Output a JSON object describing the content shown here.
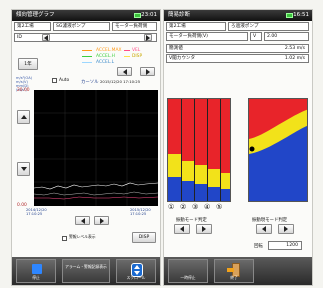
{
  "left": {
    "title": "傾向管理グラフ",
    "time": "23:01",
    "battery_color": "#3cc23c",
    "field1": "第2工場",
    "field2": "SG濾液ポンプ",
    "field3": "モーター負荷側",
    "row2_a": "ID",
    "year_button": "1年",
    "legend": {
      "l1": "ACCEL.MAX",
      "l2": "VEL",
      "l3": "ACCEL.H",
      "l4": "ACCEL.L",
      "l5": "DISP"
    },
    "auto_label": "Auto",
    "y_unit_text": "m/s²(OA)\nm/s(V)\nmm(D)\n(m/s²)",
    "y_top": "20.00",
    "y_bottom": "0.00",
    "cursor_text": "カーソル",
    "cursor_date": "2015/12/20 17:10:25",
    "date_start": "2014/12/20\n17:10:25",
    "date_end": "2015/12/20\n17:10:25",
    "checkbox_label": "警報レベル表示",
    "disp_button": "DISP",
    "bottom": {
      "b1": "停止",
      "b2": "アラーム・警報記録表示",
      "b3": "スクロール"
    },
    "line_colors": {
      "white": "#ffffff",
      "orange": "#ff9a1a",
      "pink": "#ff4d88",
      "green": "#3ccf3c",
      "yellow": "#ffe14d"
    }
  },
  "right": {
    "title": "簡易診断",
    "time": "16:51",
    "field1": "第2工場",
    "field2": "ろ過液ポンプ",
    "row_label": "モーター負荷側(V)",
    "row_label_v": "V",
    "row_value": "2.00",
    "measure_label": "簡測値",
    "measure_value": "2.53 m/s",
    "judge_label": "V閾カウンタ",
    "judge_value": "1.02 m/s",
    "circle_labels": [
      "①",
      "②",
      "③",
      "④",
      "⑤"
    ],
    "left_graph_label": "振動モード判定",
    "right_graph_label": "振動現モード判定",
    "bottom_label": "回転",
    "bottom_value": "1200",
    "bottom_buttons": {
      "b1": "一時停止",
      "b2": "終了"
    },
    "colors": {
      "red": "#e8242a",
      "yellow": "#f2e21a",
      "blue": "#2146c8"
    }
  }
}
